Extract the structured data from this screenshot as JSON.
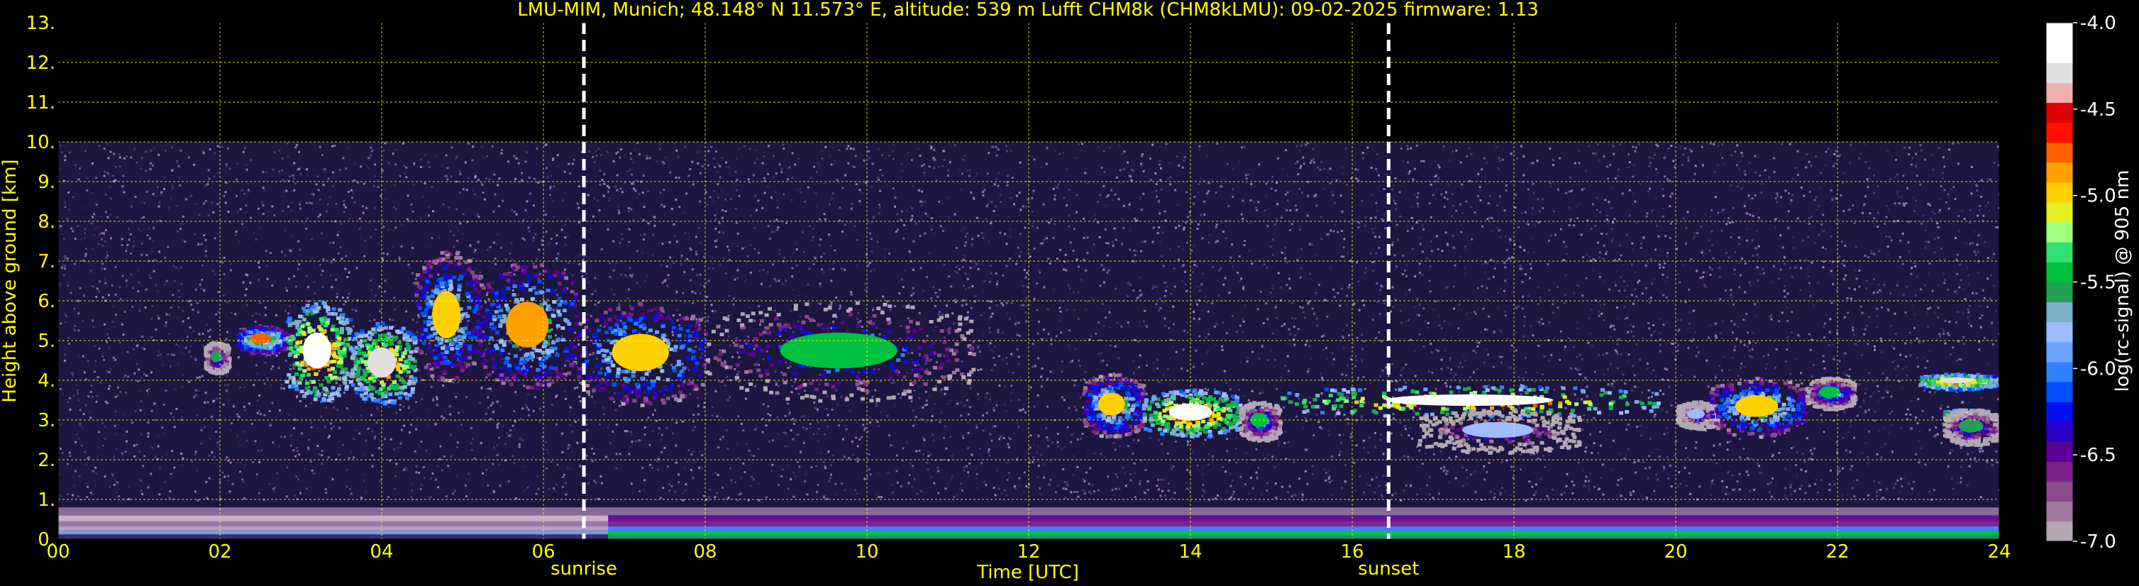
{
  "title": "LMU-MIM, Munich; 48.148° N 11.573° E, altitude: 539 m    Lufft CHM8k (CHM8kLMU): 09-02-2025    firmware: 1.13",
  "chart_data": {
    "type": "heatmap",
    "xlabel": "Time [UTC]",
    "ylabel": "Height above ground [km]",
    "xlim": [
      0,
      24
    ],
    "ylim": [
      0,
      13
    ],
    "x_ticks": [
      "00",
      "02",
      "04",
      "06",
      "08",
      "10",
      "12",
      "14",
      "16",
      "18",
      "20",
      "22",
      "24"
    ],
    "y_ticks": [
      "0.",
      "1.",
      "2.",
      "3.",
      "4.",
      "5.",
      "6.",
      "7.",
      "8.",
      "9.",
      "10.",
      "11.",
      "12.",
      "13."
    ],
    "grid": true,
    "data_ceiling_km": 10,
    "colorbar": {
      "label": "log(rc-signal) @ 905 nm",
      "ticks": [
        "-4.0",
        "-4.5",
        "-5.0",
        "-5.5",
        "-6.0",
        "-6.5",
        "-7.0"
      ],
      "range": [
        -7.0,
        -4.0
      ],
      "colors": [
        "#b4a6b4",
        "#a07aa0",
        "#8c4a8c",
        "#7a1f8a",
        "#5a0096",
        "#2a00c8",
        "#0010f0",
        "#0050ff",
        "#3080ff",
        "#6aa6ff",
        "#9fbcff",
        "#7ab0c8",
        "#20a050",
        "#00c040",
        "#30e070",
        "#a0ff80",
        "#e0f020",
        "#ffd000",
        "#ffa000",
        "#ff6000",
        "#ff1000",
        "#e00000",
        "#f0b0b0",
        "#e0e0e0",
        "#ffffff",
        "#ffffff"
      ]
    },
    "markers": [
      {
        "label": "sunrise",
        "x": 6.5
      },
      {
        "label": "sunset",
        "x": 16.45
      }
    ],
    "features": [
      {
        "kind": "cloud",
        "t_start": 1.8,
        "t_end": 2.1,
        "z_bottom": 4.2,
        "z_top": 5.0,
        "peak": -5.6
      },
      {
        "kind": "cloud",
        "t_start": 2.2,
        "t_end": 2.8,
        "z_bottom": 4.7,
        "z_top": 5.4,
        "peak": -4.8
      },
      {
        "kind": "cloud",
        "t_start": 2.8,
        "t_end": 3.6,
        "z_bottom": 3.5,
        "z_top": 6.0,
        "peak": -4.2
      },
      {
        "kind": "cloud",
        "t_start": 3.6,
        "t_end": 4.4,
        "z_bottom": 3.4,
        "z_top": 5.5,
        "peak": -4.3
      },
      {
        "kind": "cloud",
        "t_start": 4.4,
        "t_end": 5.2,
        "z_bottom": 4.0,
        "z_top": 7.3,
        "peak": -5.0
      },
      {
        "kind": "cloud",
        "t_start": 5.2,
        "t_end": 6.4,
        "z_bottom": 3.8,
        "z_top": 7.0,
        "peak": -4.9
      },
      {
        "kind": "cloud",
        "t_start": 6.4,
        "t_end": 8.0,
        "z_bottom": 3.4,
        "z_top": 6.0,
        "peak": -5.0
      },
      {
        "kind": "cloud",
        "t_start": 8.0,
        "t_end": 11.3,
        "z_bottom": 3.5,
        "z_top": 6.0,
        "peak": -5.4
      },
      {
        "kind": "cloud",
        "t_start": 12.65,
        "t_end": 13.4,
        "z_bottom": 2.6,
        "z_top": 4.2,
        "peak": -5.0
      },
      {
        "kind": "cloud",
        "t_start": 13.4,
        "t_end": 14.6,
        "z_bottom": 2.6,
        "z_top": 3.8,
        "peak": -4.2
      },
      {
        "kind": "cloud",
        "t_start": 14.6,
        "t_end": 15.1,
        "z_bottom": 2.5,
        "z_top": 3.5,
        "peak": -5.5
      },
      {
        "kind": "layer",
        "t_start": 15.1,
        "t_end": 19.8,
        "z_bottom": 3.1,
        "z_top": 3.9,
        "peak": -4.2
      },
      {
        "kind": "cloud",
        "t_start": 16.8,
        "t_end": 18.8,
        "z_bottom": 2.2,
        "z_top": 3.3,
        "peak": -5.8
      },
      {
        "kind": "cloud",
        "t_start": 20.0,
        "t_end": 20.5,
        "z_bottom": 2.8,
        "z_top": 3.5,
        "peak": -5.8
      },
      {
        "kind": "cloud",
        "t_start": 20.4,
        "t_end": 21.6,
        "z_bottom": 2.6,
        "z_top": 4.1,
        "peak": -5.0
      },
      {
        "kind": "cloud",
        "t_start": 21.6,
        "t_end": 22.2,
        "z_bottom": 3.3,
        "z_top": 4.1,
        "peak": -5.4
      },
      {
        "kind": "layer",
        "t_start": 23.3,
        "t_end": 23.85,
        "z_bottom": 3.0,
        "z_top": 3.3,
        "peak": -4.2
      },
      {
        "kind": "cloud",
        "t_start": 23.0,
        "t_end": 23.95,
        "z_bottom": 3.8,
        "z_top": 4.2,
        "peak": -4.3
      },
      {
        "kind": "cloud",
        "t_start": 23.3,
        "t_end": 24.0,
        "z_bottom": 2.4,
        "z_top": 3.3,
        "peak": -5.6
      }
    ],
    "boundary_layer": {
      "z_top": 0.8,
      "peak": -5.6
    }
  }
}
